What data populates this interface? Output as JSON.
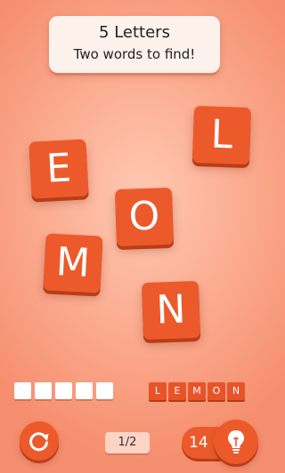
{
  "banner": {
    "line1": "5 Letters",
    "line2": "Two words to find!"
  },
  "tiles": {
    "e": "E",
    "l": "L",
    "o": "O",
    "m": "M",
    "n": "N"
  },
  "answer_slots": {
    "count": 5,
    "filled": []
  },
  "found_word": {
    "letters": [
      "L",
      "E",
      "M",
      "O",
      "N"
    ]
  },
  "footer": {
    "progress": "1/2",
    "hint_count": "14"
  },
  "icons": {
    "restart": "restart-icon",
    "hint": "lightbulb-icon"
  },
  "colors": {
    "tile": "#ec5a2b",
    "background": "#fcaf94",
    "banner": "#fdf1ec"
  }
}
